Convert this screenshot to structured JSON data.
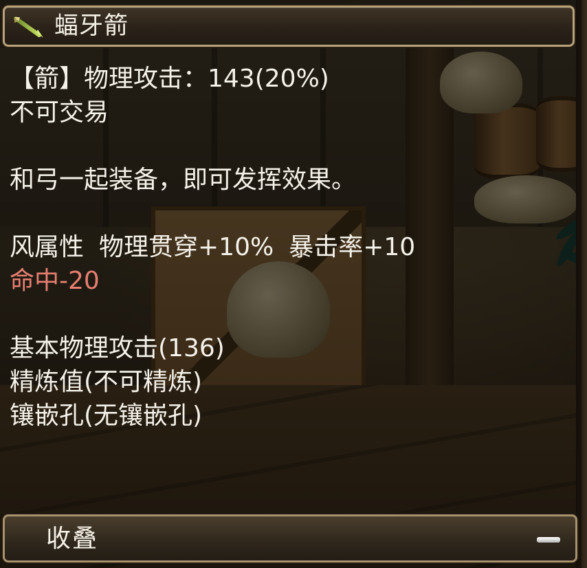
{
  "item": {
    "name": "蝠牙箭",
    "icon": "arrow-icon",
    "attack_line": "【箭】物理攻击：143(20%)",
    "trade_status": "不可交易",
    "usage_hint": "和弓一起装备，即可发挥效果。",
    "properties": [
      "风属性",
      "物理贯穿+10%",
      "暴击率+10"
    ],
    "penalty": "命中-20",
    "base_attack": "基本物理攻击(136)",
    "refine": "精炼值(不可精炼)",
    "socket": "镶嵌孔(无镶嵌孔)"
  },
  "footer": {
    "label": "收叠",
    "collapse_icon": "minus-icon"
  },
  "colors": {
    "text": "#f5f2ea",
    "penalty_text": "#e77f72",
    "frame_border": "#b9a27a"
  }
}
